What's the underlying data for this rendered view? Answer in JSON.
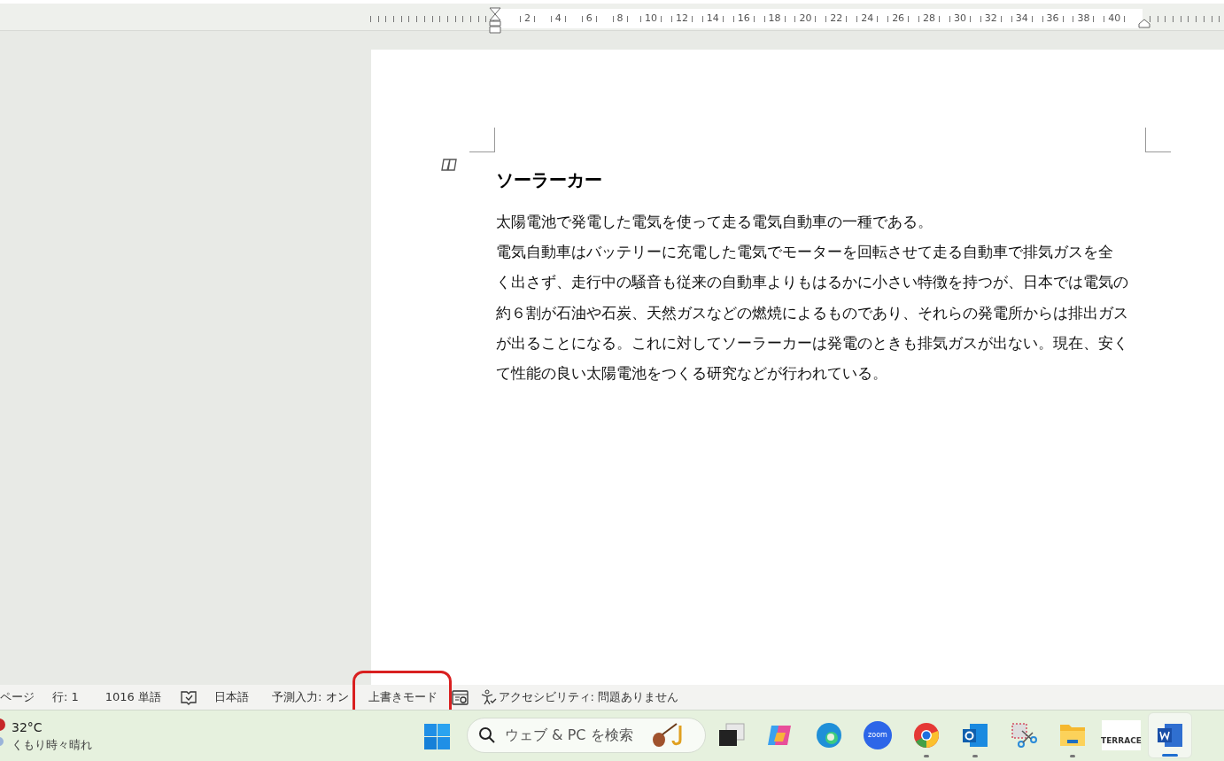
{
  "ruler": {
    "labels": [
      "2",
      "4",
      "6",
      "8",
      "10",
      "12",
      "14",
      "16",
      "18",
      "20",
      "22",
      "24",
      "26",
      "28",
      "30",
      "32",
      "34",
      "36",
      "38",
      "40"
    ]
  },
  "document": {
    "heading": "ソーラーカー",
    "lines": [
      "太陽電池で発電した電気を使って走る電気自動車の一種である。",
      "電気自動車はバッテリーに充電した電気でモーターを回転させて走る自動車で排気ガスを全",
      "く出さず、走行中の騒音も従来の自動車よりもはるかに小さい特徴を持つが、日本では電気の",
      "約６割が石油や石炭、天然ガスなどの燃焼によるものであり、それらの発電所からは排出ガス",
      "が出ることになる。これに対してソーラーカーは発電のときも排気ガスが出ない。現在、安く",
      "て性能の良い太陽電池をつくる研究などが行われている。"
    ]
  },
  "status_bar": [
    {
      "kind": "text",
      "label": "ページ",
      "highlighted": false
    },
    {
      "kind": "text",
      "label": "行: 1",
      "highlighted": false
    },
    {
      "kind": "text",
      "label": "1016 単語",
      "highlighted": false
    },
    {
      "kind": "book",
      "highlighted": false
    },
    {
      "kind": "text",
      "label": "日本語",
      "highlighted": false
    },
    {
      "kind": "text",
      "label": "予測入力: オン",
      "highlighted": false
    },
    {
      "kind": "text",
      "label": "上書きモード",
      "highlighted": true
    },
    {
      "kind": "focus",
      "highlighted": false
    },
    {
      "kind": "accessibility",
      "label": "アクセシビリティ: 問題ありません",
      "highlighted": false
    }
  ],
  "taskbar": {
    "weather": {
      "temperature": "32°C",
      "condition": "くもり時々晴れ"
    },
    "search": {
      "placeholder": "ウェブ & PC を検索"
    },
    "apps": [
      {
        "kind": "task-view",
        "running": false,
        "selected": false
      },
      {
        "kind": "copilot",
        "running": false,
        "selected": false
      },
      {
        "kind": "edge",
        "running": false,
        "selected": false
      },
      {
        "kind": "zoom",
        "label": "zoom",
        "running": false,
        "selected": false
      },
      {
        "kind": "chrome",
        "running": true,
        "selected": false
      },
      {
        "kind": "outlook",
        "running": true,
        "selected": false
      },
      {
        "kind": "snipping",
        "running": false,
        "selected": false
      },
      {
        "kind": "explorer",
        "running": true,
        "selected": false
      },
      {
        "kind": "terrace",
        "label": "TERRACE",
        "running": false,
        "selected": false
      },
      {
        "kind": "word",
        "running": true,
        "selected": true
      }
    ]
  }
}
